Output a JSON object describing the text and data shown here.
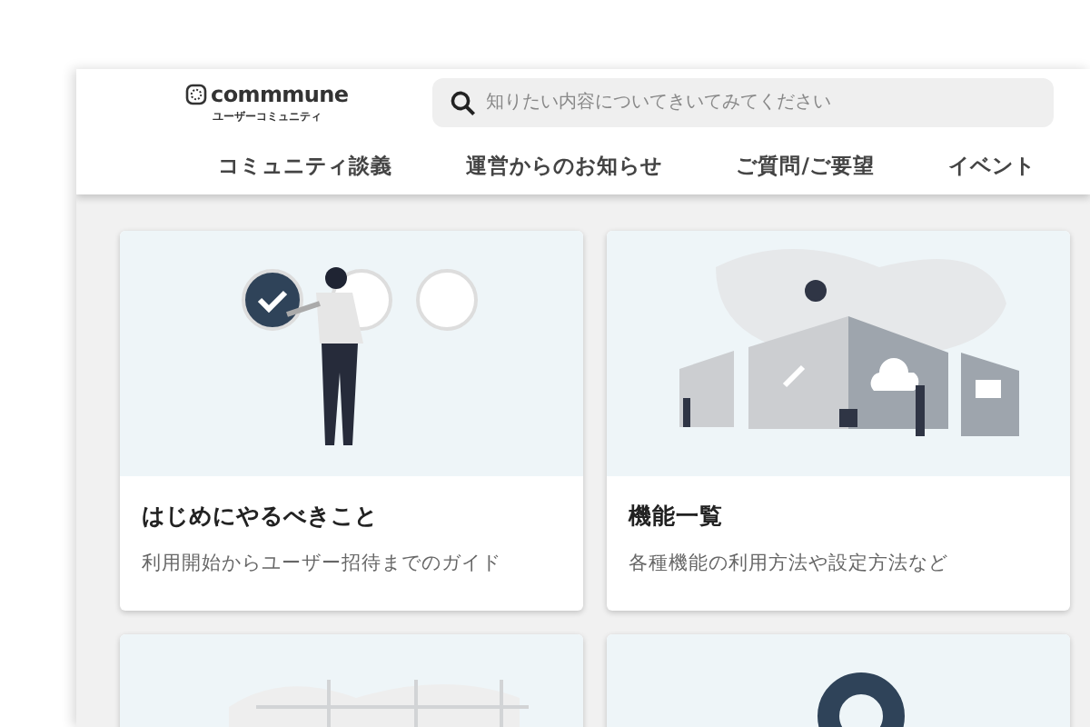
{
  "logo": {
    "name": "commmune",
    "subtitle": "ユーザーコミュニティ"
  },
  "search": {
    "placeholder": "知りたい内容についてきいてみてください"
  },
  "nav": [
    {
      "label": "コミュニティ談義"
    },
    {
      "label": "運営からのお知らせ"
    },
    {
      "label": "ご質問/ご要望"
    },
    {
      "label": "イベント"
    }
  ],
  "cards": [
    {
      "kind": "checklist",
      "title": "はじめにやるべきこと",
      "description": "利用開始からユーザー招待までのガイド"
    },
    {
      "kind": "features",
      "title": "機能一覧",
      "description": "各種機能の利用方法や設定方法など"
    },
    {
      "kind": "grid"
    },
    {
      "kind": "pin"
    }
  ]
}
